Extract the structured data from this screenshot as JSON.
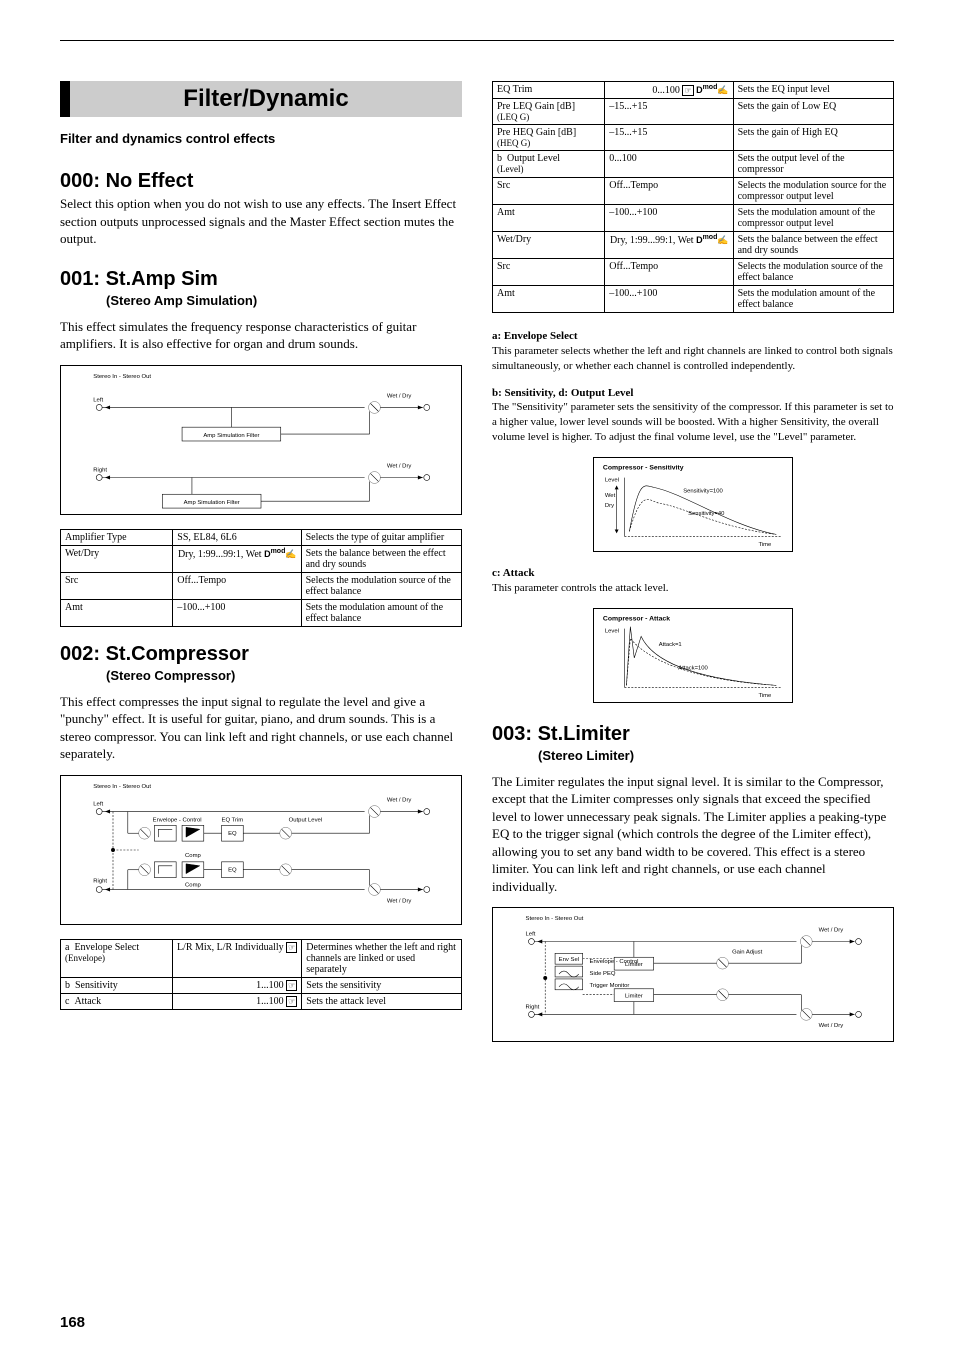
{
  "page_number": "168",
  "section": {
    "banner": "Filter/Dynamic",
    "caption": "Filter and dynamics control effects"
  },
  "fx000": {
    "title": "000: No Effect",
    "body": "Select this option when you do not wish to use any effects. The Insert Effect section outputs unprocessed signals and the Master Effect section mutes the output."
  },
  "fx001": {
    "title": "001: St.Amp Sim",
    "subtitle": "(Stereo Amp Simulation)",
    "body": "This effect simulates the frequency response characteristics of guitar amplifiers. It is also effective for organ and drum sounds.",
    "diagram_title": "Stereo In - Stereo Out",
    "diagram_box": "Amp Simulation Filter",
    "diagram_wet": "Wet / Dry",
    "table": [
      {
        "a": "Amplifier Type",
        "b": "SS, EL84, 6L6",
        "c": "Selects the type of guitar amplifier"
      },
      {
        "a": "Wet/Dry",
        "b": "Dry, 1:99...99:1, Wet",
        "c": "Sets the balance between the effect and dry sounds",
        "icon": "dmod"
      },
      {
        "a": "Src",
        "b": "Off...Tempo",
        "c": "Selects the modulation source of the effect balance"
      },
      {
        "a": "Amt",
        "b": "–100...+100",
        "c": "Sets the modulation amount of the effect balance"
      }
    ]
  },
  "fx002": {
    "title": "002: St.Compressor",
    "subtitle": "(Stereo Compressor)",
    "body": "This effect compresses the input signal to regulate the level and give a \"punchy\" effect. It is useful for guitar, piano, and drum sounds. This is a stereo compressor. You can link left and right channels, or use each channel separately.",
    "diagram_title": "Stereo In - Stereo Out",
    "diagram_wet": "Wet / Dry",
    "table1": [
      {
        "a": "Envelope Select\n(Envelope)",
        "b": "L/R Mix, L/R Individually",
        "c": "Determines whether the left and right channels are linked or used separately",
        "icon": "lr",
        "pagea": "a"
      },
      {
        "a": "Sensitivity",
        "b": "1...100",
        "c": "Sets the sensitivity",
        "icon": "lr",
        "pagea": "b"
      },
      {
        "a": "Attack",
        "b": "1...100",
        "c": "Sets the attack level",
        "icon": "lr",
        "pagea": "c"
      }
    ],
    "table2": [
      {
        "a": "EQ Trim",
        "b": "0...100",
        "c": "Sets the EQ input level",
        "iconset": "lrdmod"
      },
      {
        "a": "Pre LEQ Gain [dB]\n(LEQ G)",
        "b": "–15...+15",
        "c": "Sets the gain of Low EQ"
      },
      {
        "a": "Pre HEQ Gain [dB]\n(HEQ G)",
        "b": "–15...+15",
        "c": "Sets the gain of High EQ"
      },
      {
        "a": "Output Level\n(Level)",
        "b": "0...100",
        "c": "Sets the output level of the compressor",
        "pagea": "b"
      },
      {
        "a": "Src",
        "b": "Off...Tempo",
        "c": "Selects the modulation source for the compressor output level"
      },
      {
        "a": "Amt",
        "b": "–100...+100",
        "c": "Sets the modulation amount of the compressor output level"
      },
      {
        "a": "Wet/Dry",
        "b": "Dry, 1:99...99:1, Wet",
        "c": "Sets the balance between the effect and dry sounds",
        "icon": "dmod"
      },
      {
        "a": "Src",
        "b": "Off...Tempo",
        "c": "Selects the modulation source of the effect balance"
      },
      {
        "a": "Amt",
        "b": "–100...+100",
        "c": "Sets the modulation amount of the effect balance"
      }
    ],
    "note_a": "This parameter selects whether the left and right channels are linked to control both signals simultaneously, or whether each channel is controlled independently.",
    "note_b": "The \"Sensitivity\" parameter sets the sensitivity of the compressor. If this parameter is set to a higher value, lower level sounds will be boosted. With a higher Sensitivity, the overall volume level is higher. To adjust the final volume level, use the \"Level\" parameter.",
    "note_c": "This parameter controls the attack level.",
    "sens_labels": {
      "title": "Compressor - Sensitivity",
      "y": "Level",
      "x": "Time",
      "h": "Sensitivity=100",
      "l": "Sensitivity=40",
      "dry": "Dry",
      "wet": "Wet"
    },
    "att_labels": {
      "title": "Compressor - Attack",
      "y": "Level",
      "x": "Time",
      "a": "Attack=1",
      "b": "Attack=100"
    }
  },
  "fx003": {
    "title": "003: St.Limiter",
    "subtitle": "(Stereo Limiter)",
    "body": "The Limiter regulates the input signal level. It is similar to the Compressor, except that the Limiter compresses only signals that exceed the specified level to lower unnecessary peak signals. The Limiter applies a peaking-type EQ to the trigger signal (which controls the degree of the Limiter effect), allowing you to set any band width to be covered. This effect is a stereo limiter. You can link left and right channels, or use each channel individually.",
    "diagram_title": "Stereo In - Stereo Out",
    "diagram_wet": "Wet / Dry"
  }
}
